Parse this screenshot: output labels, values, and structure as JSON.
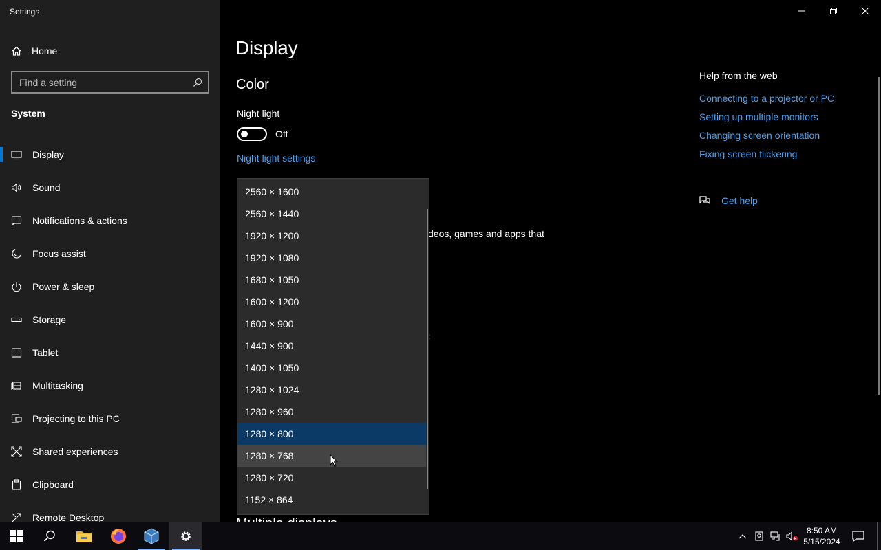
{
  "window": {
    "title": "Settings"
  },
  "sidebar": {
    "home_label": "Home",
    "search_placeholder": "Find a setting",
    "section_label": "System",
    "items": [
      {
        "label": "Display",
        "icon": "monitor-icon",
        "active": true
      },
      {
        "label": "Sound",
        "icon": "speaker-icon"
      },
      {
        "label": "Notifications & actions",
        "icon": "notification-icon"
      },
      {
        "label": "Focus assist",
        "icon": "moon-icon"
      },
      {
        "label": "Power & sleep",
        "icon": "power-icon"
      },
      {
        "label": "Storage",
        "icon": "storage-icon"
      },
      {
        "label": "Tablet",
        "icon": "tablet-icon"
      },
      {
        "label": "Multitasking",
        "icon": "multitasking-icon"
      },
      {
        "label": "Projecting to this PC",
        "icon": "projecting-icon"
      },
      {
        "label": "Shared experiences",
        "icon": "shared-icon"
      },
      {
        "label": "Clipboard",
        "icon": "clipboard-icon"
      },
      {
        "label": "Remote Desktop",
        "icon": "remote-desktop-icon"
      }
    ]
  },
  "main": {
    "title": "Display",
    "color_heading": "Color",
    "night_light_label": "Night light",
    "night_light_state": "Off",
    "night_light_link": "Night light settings",
    "partial_text": "deos, games and apps that",
    "partial_dot": ":",
    "partial_heading": "Multiple displays"
  },
  "help": {
    "title": "Help from the web",
    "links": [
      "Connecting to a projector or PC",
      "Setting up multiple monitors",
      "Changing screen orientation",
      "Fixing screen flickering"
    ],
    "get_help": "Get help"
  },
  "dropdown": {
    "options": [
      "2560 × 1600",
      "2560 × 1440",
      "1920 × 1200",
      "1920 × 1080",
      "1680 × 1050",
      "1600 × 1200",
      "1600 × 900",
      "1440 × 900",
      "1400 × 1050",
      "1280 × 1024",
      "1280 × 960",
      "1280 × 800",
      "1280 × 768",
      "1280 × 720",
      "1152 × 864"
    ],
    "selected": "1280 × 800",
    "hovered": "1280 × 768"
  },
  "taskbar": {
    "apps": [
      "start-icon",
      "search-icon",
      "file-explorer-icon",
      "firefox-icon",
      "virtualbox-icon",
      "settings-icon"
    ],
    "time": "8:50 AM",
    "date": "5/15/2024"
  },
  "colors": {
    "accent": "#0078d7",
    "link": "#4aa0f0",
    "selected_option": "#0b3a66",
    "sidebar_bg": "#1f1f1f"
  }
}
